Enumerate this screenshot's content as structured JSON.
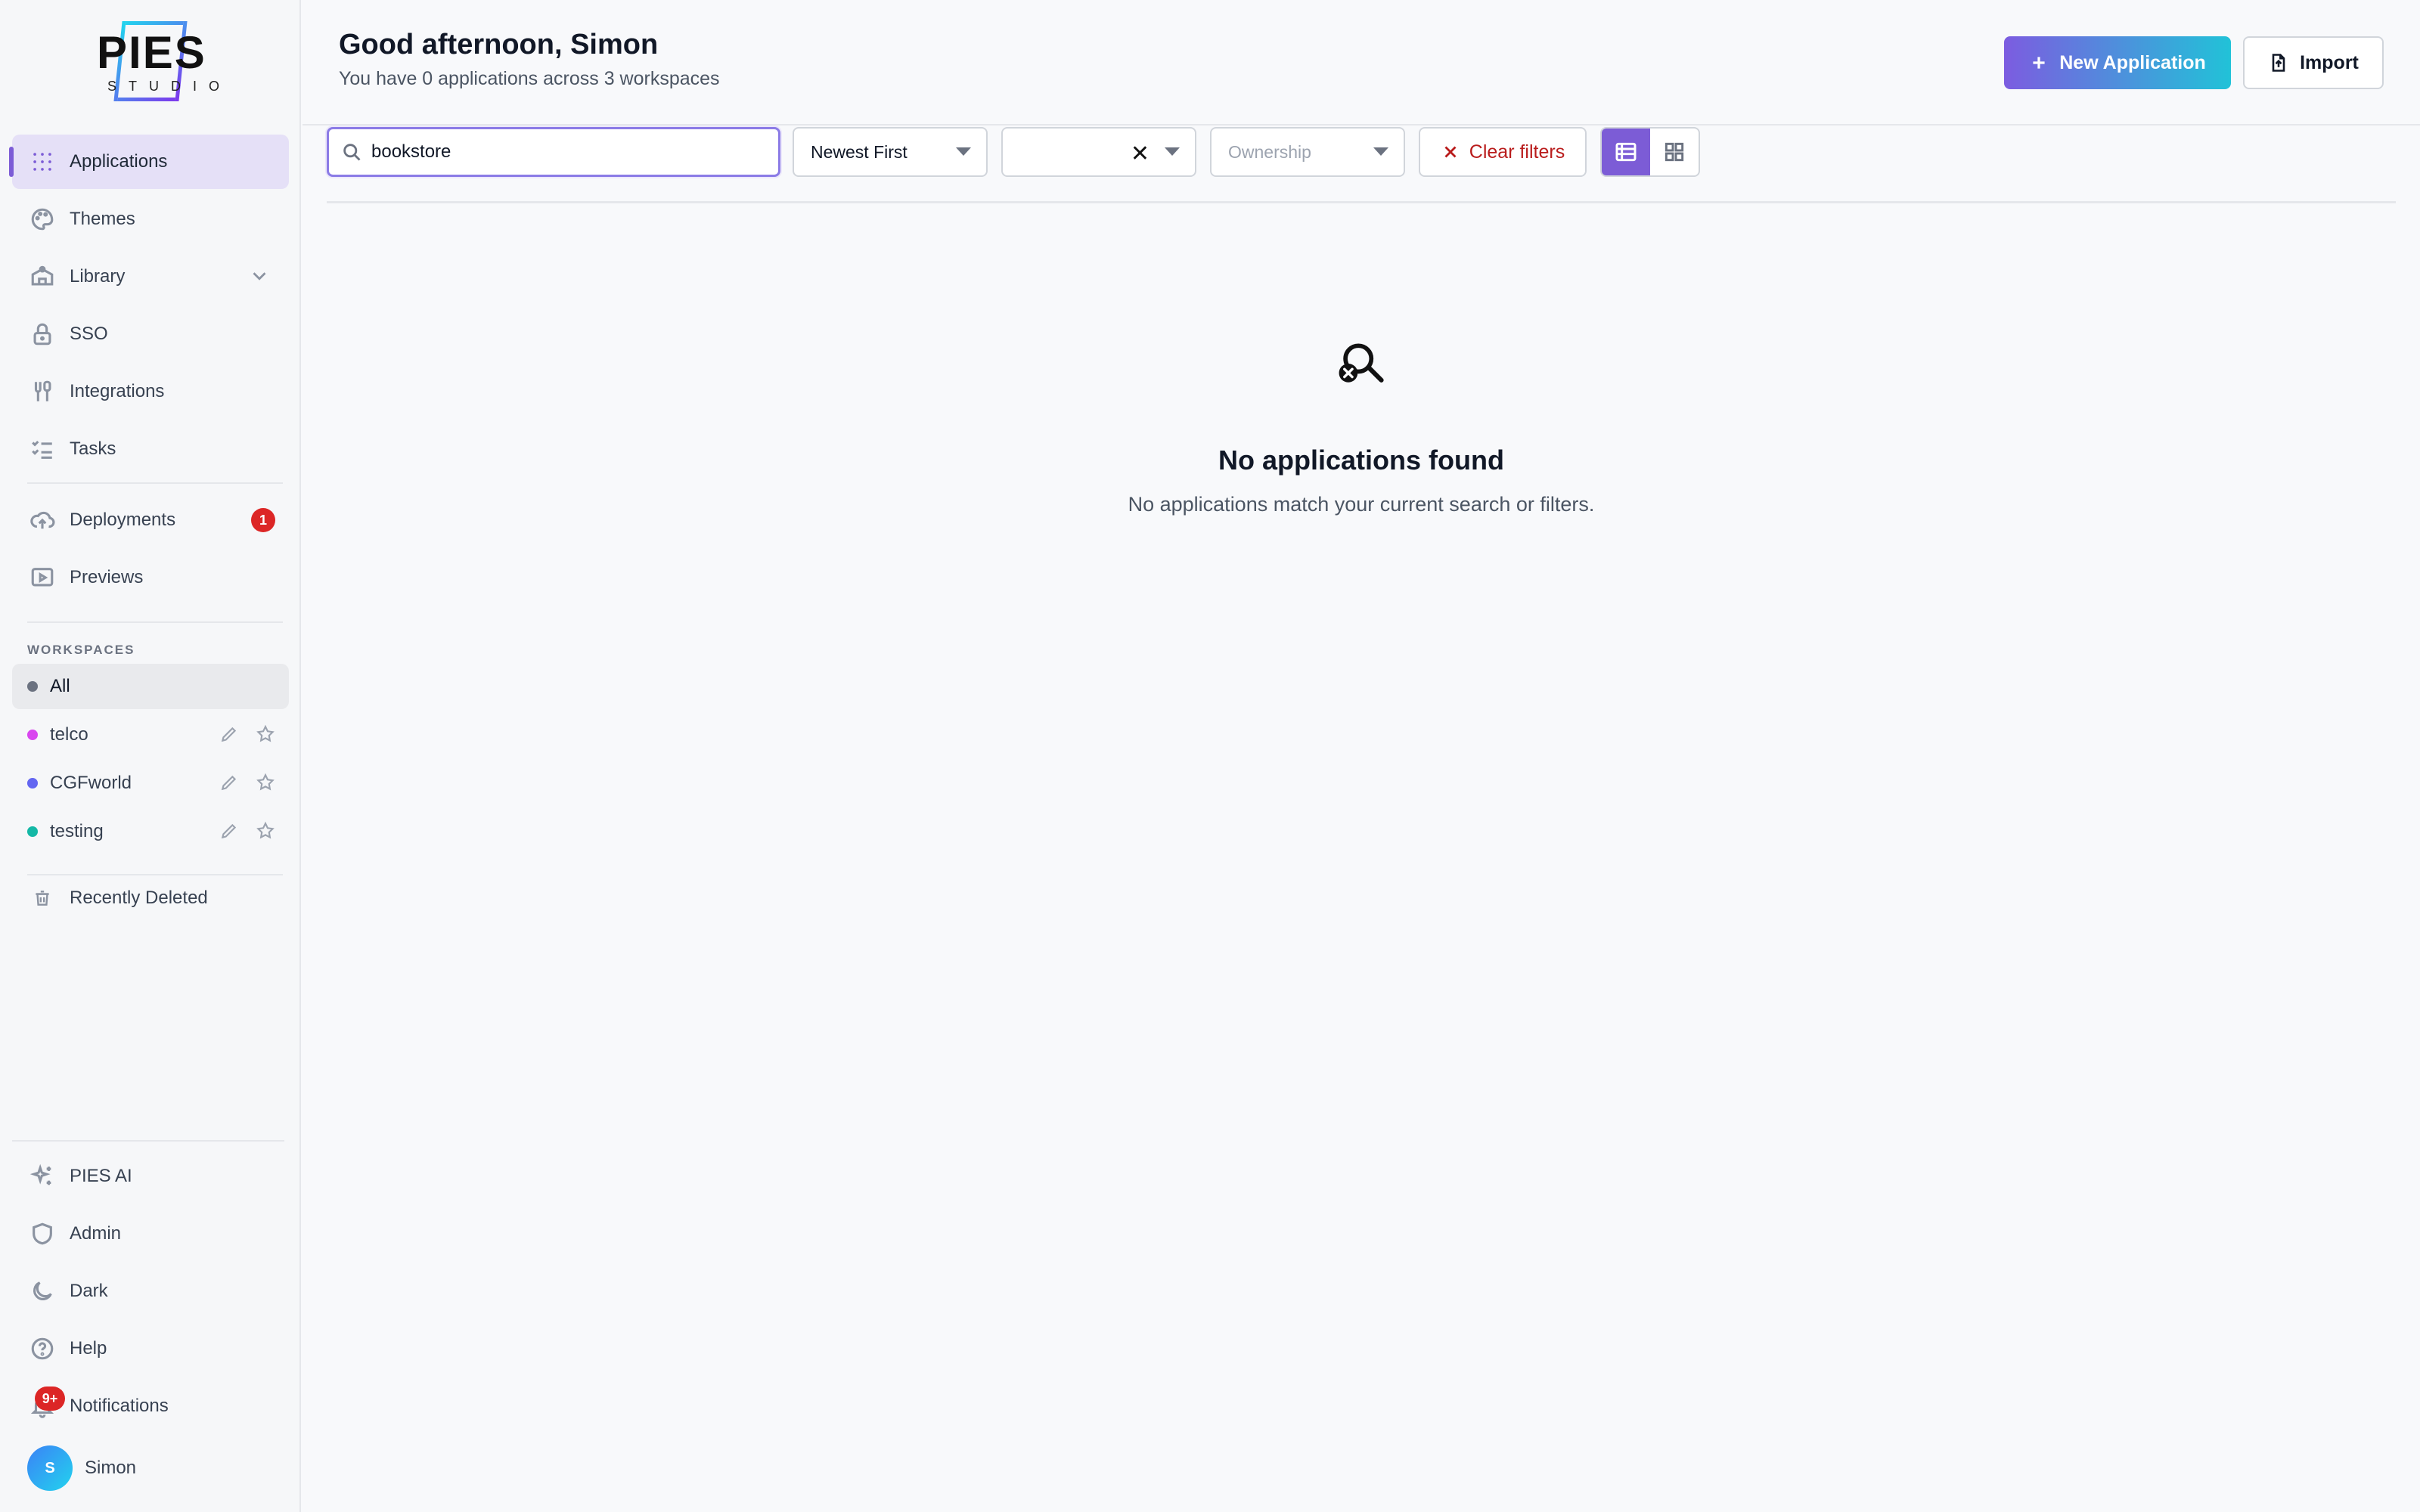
{
  "brand": {
    "name": "PIES",
    "sub": "STUDIO"
  },
  "sidebar": {
    "items": [
      {
        "label": "Applications",
        "icon": "grid-dots-icon"
      },
      {
        "label": "Themes",
        "icon": "palette-icon"
      },
      {
        "label": "Library",
        "icon": "library-icon"
      },
      {
        "label": "SSO",
        "icon": "lock-icon"
      },
      {
        "label": "Integrations",
        "icon": "plug-icon"
      },
      {
        "label": "Tasks",
        "icon": "tasks-icon"
      },
      {
        "label": "Deployments",
        "icon": "cloud-upload-icon",
        "badge": "1"
      },
      {
        "label": "Previews",
        "icon": "play-screen-icon"
      }
    ],
    "workspaces_label": "WORKSPACES",
    "workspaces": [
      {
        "label": "All",
        "color": "#6b7280"
      },
      {
        "label": "telco",
        "color": "#d946ef"
      },
      {
        "label": "CGFworld",
        "color": "#6366f1"
      },
      {
        "label": "testing",
        "color": "#14b8a6"
      }
    ],
    "recently_deleted": "Recently Deleted",
    "bottom": [
      {
        "label": "PIES AI",
        "icon": "sparkles-icon"
      },
      {
        "label": "Admin",
        "icon": "shield-icon"
      },
      {
        "label": "Dark",
        "icon": "moon-icon"
      },
      {
        "label": "Help",
        "icon": "help-circle-icon"
      },
      {
        "label": "Notifications",
        "icon": "bell-icon",
        "badge": "9+"
      }
    ],
    "user": {
      "initial": "S",
      "name": "Simon"
    }
  },
  "header": {
    "greeting": "Good afternoon, Simon",
    "subline": "You have 0 applications across 3 workspaces",
    "new_button": "New Application",
    "import_button": "Import"
  },
  "filters": {
    "search_value": "bookstore",
    "sort_value": "Newest First",
    "workspace_value": "",
    "ownership_placeholder": "Ownership",
    "clear_label": "Clear filters",
    "view": "list"
  },
  "empty": {
    "title": "No applications found",
    "subtitle": "No applications match your current search or filters."
  },
  "colors": {
    "accent": "#7c5cd6",
    "danger": "#dc2626"
  }
}
